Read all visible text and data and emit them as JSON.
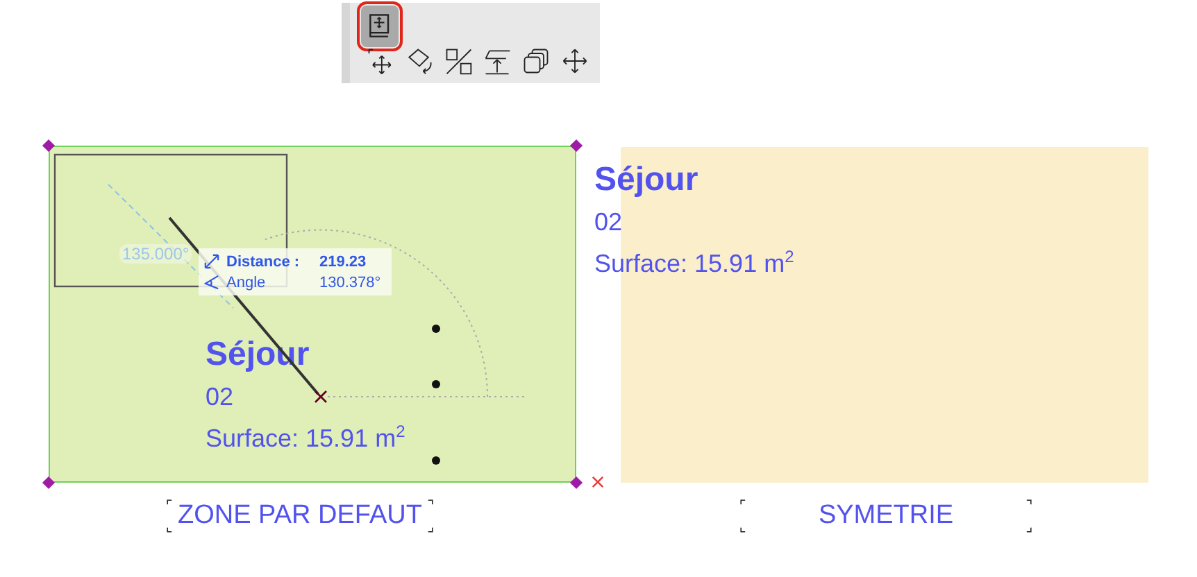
{
  "toolbar": {
    "buttons": [
      {
        "kind": "edit",
        "selected": true
      },
      {
        "kind": "drag",
        "selected": false
      },
      {
        "kind": "rotate",
        "selected": false
      },
      {
        "kind": "mirror",
        "selected": false
      },
      {
        "kind": "elevate",
        "selected": false
      },
      {
        "kind": "multiply",
        "selected": false
      },
      {
        "kind": "move",
        "selected": false
      }
    ]
  },
  "zones": [
    {
      "name": "Séjour",
      "number": "02",
      "surface": "Surface: 15.91 m$^{2}$",
      "color": "#e0efb8",
      "selected": true,
      "label": "ZONE PAR DEFAUT"
    },
    {
      "name": "Séjour",
      "number": "02",
      "surface": "Surface: 15.91 m$^{2}$",
      "color": "#faeecb",
      "selected": false,
      "label": "SYMETRIE"
    }
  ],
  "measurement": {
    "guide_angle": "135.000°",
    "distance_label": "Distance :",
    "distance": "219.23",
    "angle_label": "Angle",
    "angle": "130.378°"
  }
}
